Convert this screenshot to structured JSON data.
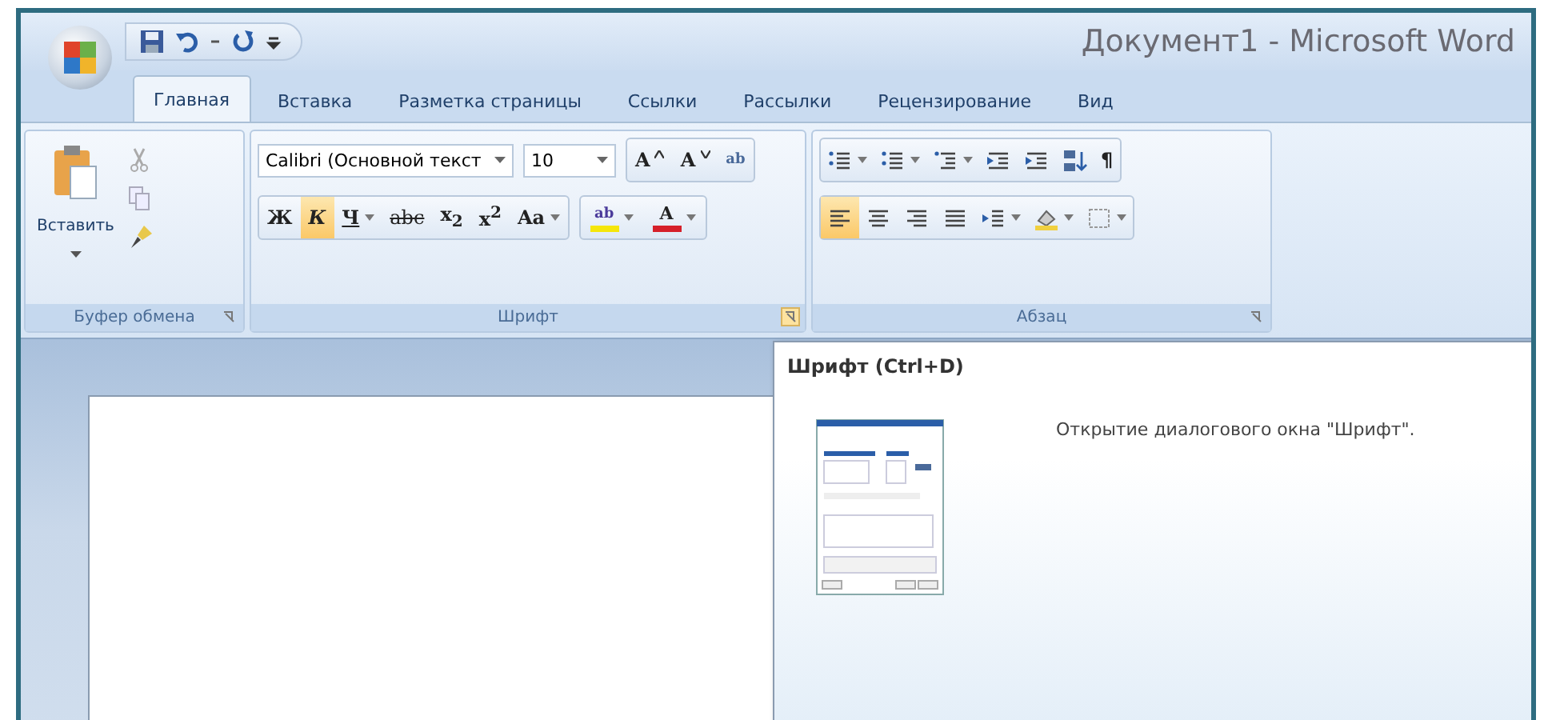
{
  "window": {
    "title": "Документ1 - Microsoft Word"
  },
  "tabs": [
    {
      "label": "Главная",
      "selected": true
    },
    {
      "label": "Вставка",
      "selected": false
    },
    {
      "label": "Разметка страницы",
      "selected": false
    },
    {
      "label": "Ссылки",
      "selected": false
    },
    {
      "label": "Рассылки",
      "selected": false
    },
    {
      "label": "Рецензирование",
      "selected": false
    },
    {
      "label": "Вид",
      "selected": false
    }
  ],
  "clipboard": {
    "paste_label": "Вставить",
    "group_label": "Буфер обмена",
    "launcher_hovered": false
  },
  "font": {
    "font_name": "Calibri (Основной текст",
    "font_size": "10",
    "group_label": "Шрифт",
    "launcher_hovered": true,
    "row_1": [
      {
        "kind": "grow",
        "label": "A"
      },
      {
        "kind": "shrink",
        "label": "A"
      },
      {
        "kind": "clear",
        "label": "ab"
      }
    ],
    "row_2": [
      {
        "label": "Ж",
        "kind": "bold",
        "selected": false,
        "dropdown": false
      },
      {
        "label": "К",
        "kind": "italic",
        "selected": true,
        "dropdown": false
      },
      {
        "label": "Ч",
        "kind": "underline",
        "selected": false,
        "dropdown": true
      },
      {
        "label": "abc",
        "kind": "strike",
        "selected": false,
        "dropdown": false
      },
      {
        "label": "x$_{2}$",
        "kind": "plain",
        "selected": false,
        "dropdown": false
      },
      {
        "label": "x$^{2}$",
        "kind": "plain",
        "selected": false,
        "dropdown": false
      },
      {
        "label": "Aa",
        "kind": "plain",
        "selected": false,
        "dropdown": true
      }
    ],
    "row_3": [
      {
        "label": "ab",
        "kind": "highlight",
        "color": "#f5e60a",
        "dropdown": true
      },
      {
        "label": "A",
        "kind": "font-color",
        "color": "#d6202a",
        "dropdown": true
      }
    ]
  },
  "paragraph": {
    "group_label": "Абзац",
    "launcher_hovered": false,
    "row_1": [
      {
        "kind": "bullets",
        "selected": false,
        "dropdown": true
      },
      {
        "kind": "numbering",
        "selected": false,
        "dropdown": true
      },
      {
        "kind": "multilevel",
        "selected": false,
        "dropdown": true
      },
      {
        "kind": "outdent",
        "selected": false,
        "dropdown": false
      },
      {
        "kind": "indent",
        "selected": false,
        "dropdown": false
      },
      {
        "kind": "sort",
        "selected": false,
        "dropdown": false
      },
      {
        "kind": "pilcrow",
        "label": "¶",
        "selected": false,
        "dropdown": false
      }
    ],
    "row_2": [
      {
        "kind": "align-left",
        "selected": true,
        "dropdown": false
      },
      {
        "kind": "align-center",
        "selected": false,
        "dropdown": false
      },
      {
        "kind": "align-right",
        "selected": false,
        "dropdown": false
      },
      {
        "kind": "justify",
        "selected": false,
        "dropdown": false
      },
      {
        "kind": "line-spacing",
        "selected": false,
        "dropdown": true
      },
      {
        "kind": "shading",
        "selected": false,
        "dropdown": true
      },
      {
        "kind": "borders",
        "selected": false,
        "dropdown": true
      }
    ]
  },
  "tooltip": {
    "title": "Шрифт (Ctrl+D)",
    "description": "Открытие диалогового окна \"Шрифт\"."
  }
}
